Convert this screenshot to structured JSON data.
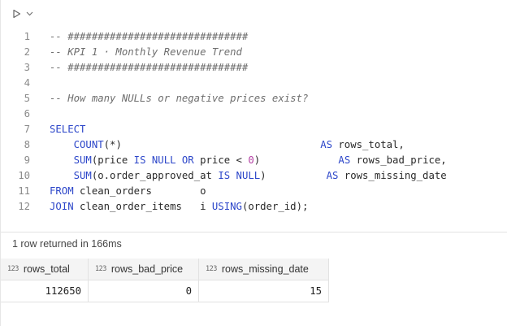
{
  "toolbar": {
    "run_icon": "play-icon",
    "menu_icon": "chevron-down-icon"
  },
  "editor": {
    "lines": [
      {
        "n": "1",
        "tokens": [
          [
            "cm",
            "-- ##############################"
          ]
        ]
      },
      {
        "n": "2",
        "tokens": [
          [
            "cm",
            "-- KPI 1 · Monthly Revenue Trend"
          ]
        ]
      },
      {
        "n": "3",
        "tokens": [
          [
            "cm",
            "-- ##############################"
          ]
        ]
      },
      {
        "n": "4",
        "tokens": []
      },
      {
        "n": "5",
        "tokens": [
          [
            "cm",
            "-- How many NULLs or negative prices exist?"
          ]
        ]
      },
      {
        "n": "6",
        "tokens": []
      },
      {
        "n": "7",
        "tokens": [
          [
            "kw",
            "SELECT"
          ]
        ]
      },
      {
        "n": "8",
        "tokens": [
          [
            "",
            "    "
          ],
          [
            "fn",
            "COUNT"
          ],
          [
            "",
            "(*)                                 "
          ],
          [
            "kw",
            "AS"
          ],
          [
            "",
            " rows_total,"
          ]
        ]
      },
      {
        "n": "9",
        "tokens": [
          [
            "",
            "    "
          ],
          [
            "fn",
            "SUM"
          ],
          [
            "",
            "(price "
          ],
          [
            "kw",
            "IS NULL OR"
          ],
          [
            "",
            " price < "
          ],
          [
            "num",
            "0"
          ],
          [
            "",
            ")             "
          ],
          [
            "kw",
            "AS"
          ],
          [
            "",
            " rows_bad_price,"
          ]
        ]
      },
      {
        "n": "10",
        "tokens": [
          [
            "",
            "    "
          ],
          [
            "fn",
            "SUM"
          ],
          [
            "",
            "(o.order_approved_at "
          ],
          [
            "kw",
            "IS NULL"
          ],
          [
            "",
            ")          "
          ],
          [
            "kw",
            "AS"
          ],
          [
            "",
            " rows_missing_date"
          ]
        ]
      },
      {
        "n": "11",
        "tokens": [
          [
            "kw",
            "FROM"
          ],
          [
            "",
            " clean_orders        o"
          ]
        ]
      },
      {
        "n": "12",
        "tokens": [
          [
            "kw",
            "JOIN"
          ],
          [
            "",
            " clean_order_items   i "
          ],
          [
            "kw",
            "USING"
          ],
          [
            "",
            "(order_id);"
          ]
        ]
      }
    ]
  },
  "result": {
    "status": "1 row returned in 166ms",
    "type_label": "123",
    "columns": [
      "rows_total",
      "rows_bad_price",
      "rows_missing_date"
    ],
    "rows": [
      [
        "112650",
        "0",
        "15"
      ]
    ]
  },
  "colors": {
    "keyword": "#2c46c9",
    "number": "#b33ea3",
    "comment": "#6e6e6e"
  }
}
